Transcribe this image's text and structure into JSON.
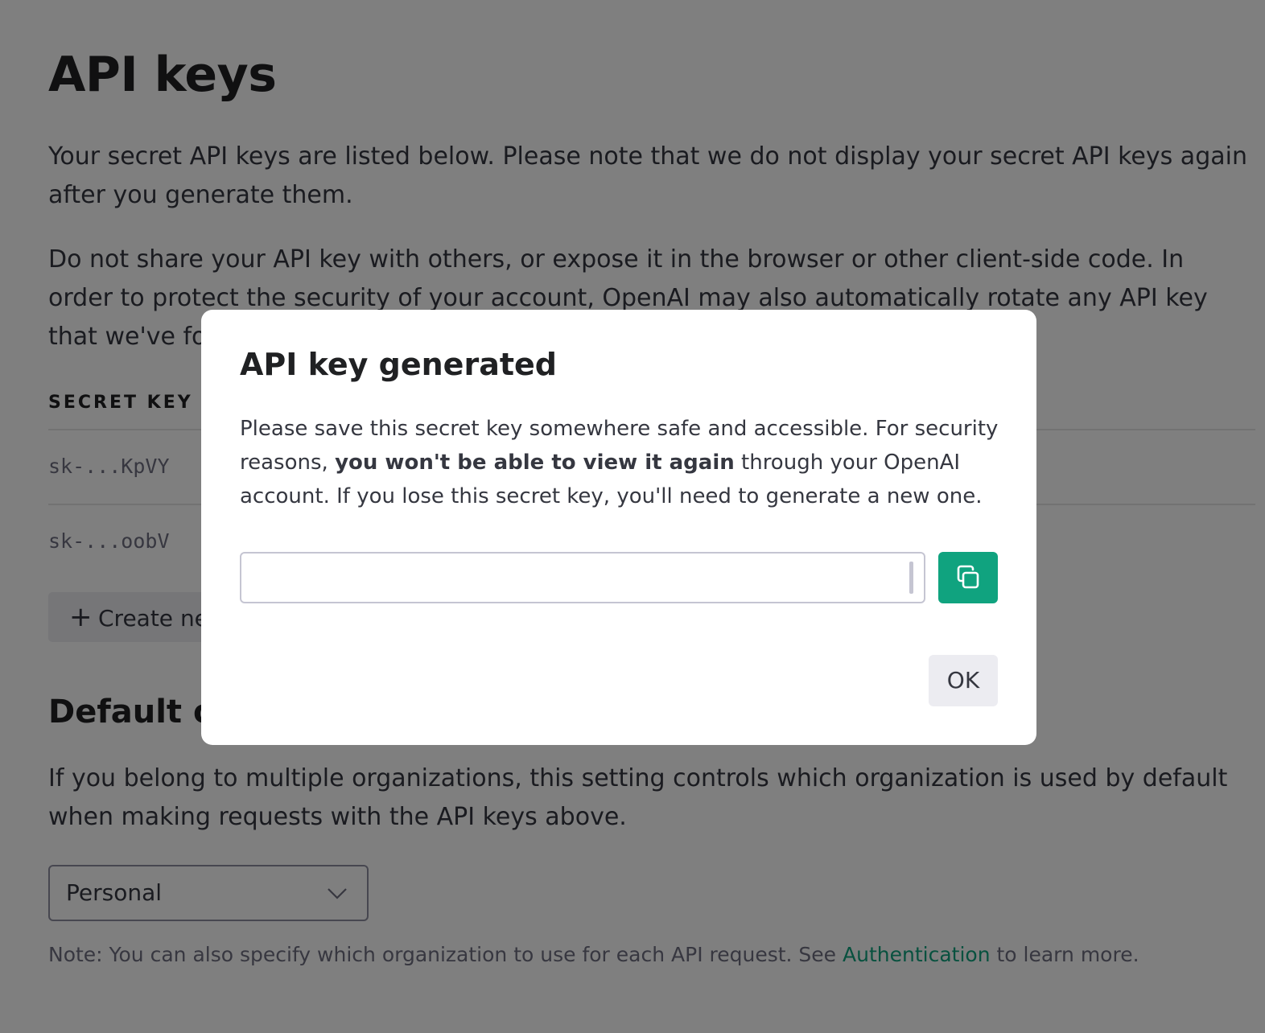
{
  "page": {
    "title": "API keys",
    "intro_1": "Your secret API keys are listed below. Please note that we do not display your secret API keys again after you generate them.",
    "intro_2": "Do not share your API key with others, or expose it in the browser or other client-side code. In order to protect the security of your account, OpenAI may also automatically rotate any API key that we've found has leaked publicly.",
    "table_header": "SECRET KEY",
    "keys": [
      "sk-...KpVY",
      "sk-...oobV"
    ],
    "create_button_label": "Create new secret key",
    "default_org_title": "Default organization",
    "default_org_desc": "If you belong to multiple organizations, this setting controls which organization is used by default when making requests with the API keys above.",
    "org_select_value": "Personal",
    "note_prefix": "Note: You can also specify which organization to use for each API request. See ",
    "note_link": "Authentication",
    "note_suffix": " to learn more."
  },
  "modal": {
    "title": "API key generated",
    "desc_prefix": "Please save this secret key somewhere safe and accessible. For security reasons, ",
    "desc_bold": "you won't be able to view it again",
    "desc_suffix": " through your OpenAI account. If you lose this secret key, you'll need to generate a new one.",
    "key_value": "",
    "copy_icon": "copy-icon",
    "ok_label": "OK"
  },
  "colors": {
    "accent": "#10a37f",
    "overlay": "rgba(0,0,0,0.5)"
  }
}
